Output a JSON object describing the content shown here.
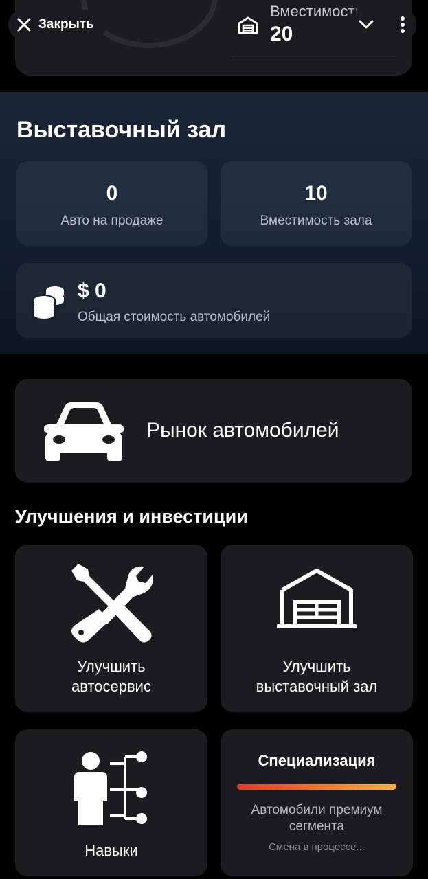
{
  "header": {
    "close_label": "Закрыть",
    "capacity_label": "Вместимость",
    "capacity_value": "20",
    "icons": {
      "close": "close-icon",
      "expand": "chevron-down-icon",
      "menu": "more-vertical-icon",
      "capacity": "garage-icon"
    }
  },
  "showroom": {
    "title": "Выставочный зал",
    "cars_on_sale": {
      "value": "0",
      "label": "Авто на продаже"
    },
    "hall_capacity": {
      "value": "10",
      "label": "Вместимость зала"
    },
    "total_value": {
      "value": "$ 0",
      "label": "Общая стоимость автомобилей"
    }
  },
  "market": {
    "label": "Рынок автомобилей",
    "icon": "car-icon"
  },
  "upgrades": {
    "title": "Улучшения и инвестиции",
    "service": {
      "line1": "Улучшить",
      "line2": "автосервис",
      "icon": "tools-icon"
    },
    "showroom": {
      "line1": "Улучшить",
      "line2": "выставочный зал",
      "icon": "garage-icon"
    },
    "skills": {
      "label": "Навыки",
      "icon": "skills-tree-icon"
    },
    "specialization": {
      "title": "Специализация",
      "desc_line1": "Автомобили премиум",
      "desc_line2": "сегмента",
      "status": "Смена в процессе...",
      "progress": 1.0
    }
  },
  "colors": {
    "background": "#000000",
    "card": "#1c1c1e",
    "showroom_bg": "#142030",
    "gradient_start": "#e03a2a",
    "gradient_end": "#f0b04a"
  }
}
